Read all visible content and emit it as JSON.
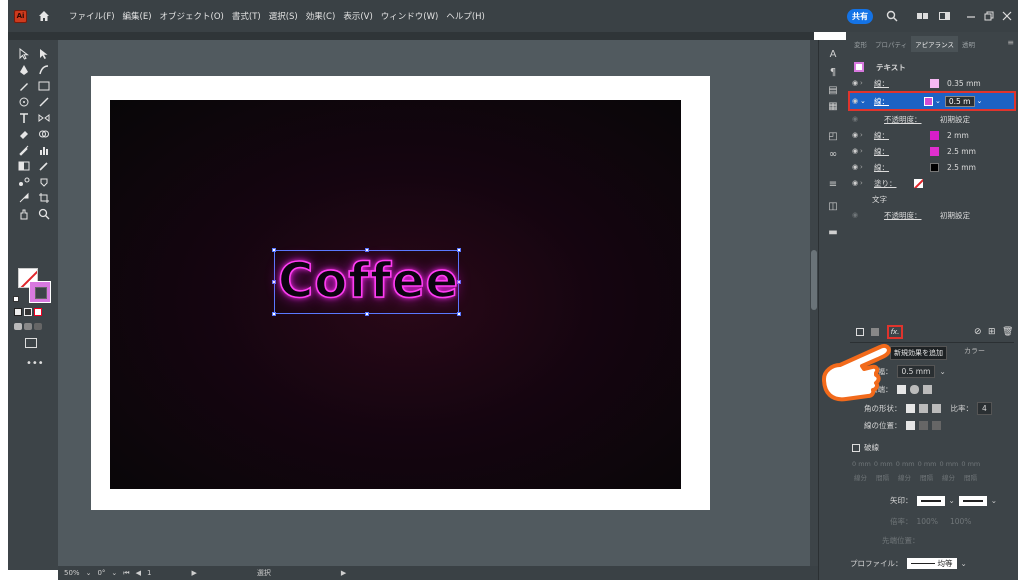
{
  "app": {
    "logo_text": "Ai"
  },
  "menu": [
    "ファイル(F)",
    "編集(E)",
    "オブジェクト(O)",
    "書式(T)",
    "選択(S)",
    "効果(C)",
    "表示(V)",
    "ウィンドウ(W)",
    "ヘルプ(H)"
  ],
  "header": {
    "share_label": "共有"
  },
  "canvas": {
    "text": "Coffee"
  },
  "status": {
    "zoom": "50%",
    "rotate": "0°",
    "artboard": "1",
    "mode": "選択"
  },
  "panel": {
    "tabs": [
      "変形",
      "プロパティ",
      "アピアランス",
      "透明"
    ],
    "active_tab": "アピアランス",
    "object_label": "テキスト",
    "rows": [
      {
        "label": "線：",
        "value": "0.35 mm",
        "color": "#f5b8f3"
      },
      {
        "label": "線：",
        "value": "0.5 m",
        "color": "#d44ed4",
        "highlighted": true
      },
      {
        "label": "不透明度：",
        "value": "初期設定"
      },
      {
        "label": "線：",
        "value": "2 mm",
        "color": "#d81ec9"
      },
      {
        "label": "線：",
        "value": "2.5 mm",
        "color": "#e02fcf"
      },
      {
        "label": "線：",
        "value": "2.5 mm",
        "color": "#000000"
      },
      {
        "label": "塗り：",
        "value": ""
      },
      {
        "label": "文字",
        "value": ""
      },
      {
        "label": "不透明度：",
        "value": "初期設定"
      }
    ],
    "fx_label": "fx.",
    "tooltip": "新規効果を追加",
    "stroke": {
      "header_right": "カラー",
      "width_label": "線幅：",
      "width_value": "0.5 mm",
      "cap_label": "線端：",
      "corner_label": "角の形状：",
      "ratio_label": "比率：",
      "ratio_value": "4",
      "align_label": "線の位置：",
      "dash_label": "破線",
      "dash_units": [
        "0 mm",
        "0 mm",
        "0 mm",
        "0 mm",
        "0 mm",
        "0 mm"
      ],
      "dash_sub": [
        "線分",
        "間隔",
        "線分",
        "間隔",
        "線分",
        "間隔"
      ],
      "arrow_label": "矢印：",
      "scale_label": "倍率：",
      "scale_values": [
        "100%",
        "100%"
      ],
      "tip_label": "先端位置：",
      "profile_label": "プロファイル：",
      "profile_value": "均等"
    }
  }
}
